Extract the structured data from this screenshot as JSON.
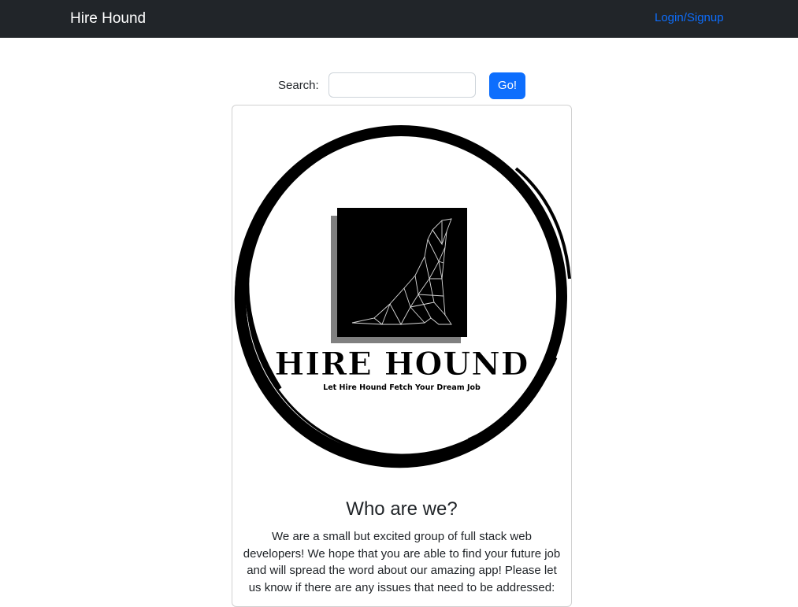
{
  "navbar": {
    "brand": "Hire Hound",
    "login_link": "Login/Signup"
  },
  "search": {
    "label": "Search:",
    "value": "",
    "placeholder": "",
    "button_label": "Go!"
  },
  "card": {
    "logo": {
      "name": "HIRE HOUND",
      "tagline": "Let Hire Hound Fetch Your Dream Job",
      "icon": "howling-dog-icon"
    },
    "title": "Who are we?",
    "text": "We are a small but excited group of full stack web developers! We hope that you are able to find your future job and will spread the word about our amazing app! Please let us know if there are any issues that need to be addressed:"
  },
  "colors": {
    "navbar_bg": "#212529",
    "link": "#0d6efd",
    "button": "#0d6efd"
  }
}
